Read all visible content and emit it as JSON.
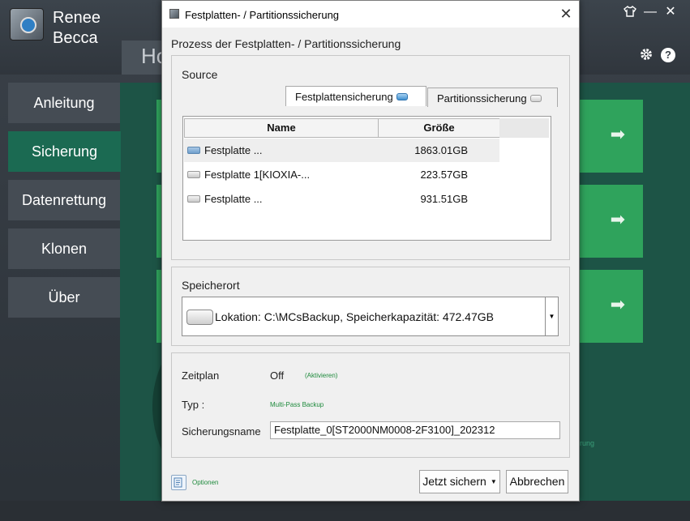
{
  "app": {
    "brand_line1": "Renee",
    "brand_line2": "Becca",
    "home_tab": "Ho",
    "window_icons": {
      "skin": "shirt-icon",
      "minimize": "—",
      "close": "✕"
    },
    "settings_icon": "gear-icon",
    "help_label": "?",
    "nav": [
      "Anleitung",
      "Sicherung",
      "Datenrettung",
      "Klonen",
      "Über"
    ],
    "active_nav": "Sicherung",
    "card_arrow": "➡",
    "faint_text": "rung",
    "accent_color": "#2fa35c"
  },
  "dialog": {
    "title": "Festplatten- / Partitionssicherung",
    "close_label": "✕",
    "heading": "Prozess der Festplatten- / Partitionssicherung",
    "source": {
      "label": "Source",
      "tabs": [
        {
          "label": "Festplattensicherung",
          "active": true,
          "icon": "disk-blue-icon"
        },
        {
          "label": "Partitionssicherung",
          "active": false,
          "icon": "disk-gray-icon"
        }
      ],
      "columns": [
        "Name",
        "Größe"
      ],
      "rows": [
        {
          "name": "Festplatte ...",
          "size": "1863.01GB",
          "selected": true,
          "icon": "disk-blue-icon"
        },
        {
          "name": "Festplatte 1[KIOXIA-...",
          "size": "223.57GB",
          "selected": false,
          "icon": "disk-gray-icon"
        },
        {
          "name": "Festplatte ...",
          "size": "931.51GB",
          "selected": false,
          "icon": "disk-gray-icon"
        }
      ]
    },
    "destination": {
      "label": "Speicherort",
      "value": "Lokation: C:\\MCsBackup, Speicherkapazität: 472.47GB",
      "arrow": "▼"
    },
    "schedule": {
      "label": "Zeitplan",
      "value": "Off",
      "activate_link": "(Aktivieren)"
    },
    "type": {
      "label": "Typ :",
      "value": "Multi-Pass Backup"
    },
    "backup_name": {
      "label": "Sicherungsname",
      "value": "Festplatte_0[ST2000NM0008-2F3100]_202312"
    },
    "options_label": "Optionen",
    "backup_now_label": "Jetzt sichern",
    "backup_now_caret": "▼",
    "cancel_label": "Abbrechen"
  }
}
